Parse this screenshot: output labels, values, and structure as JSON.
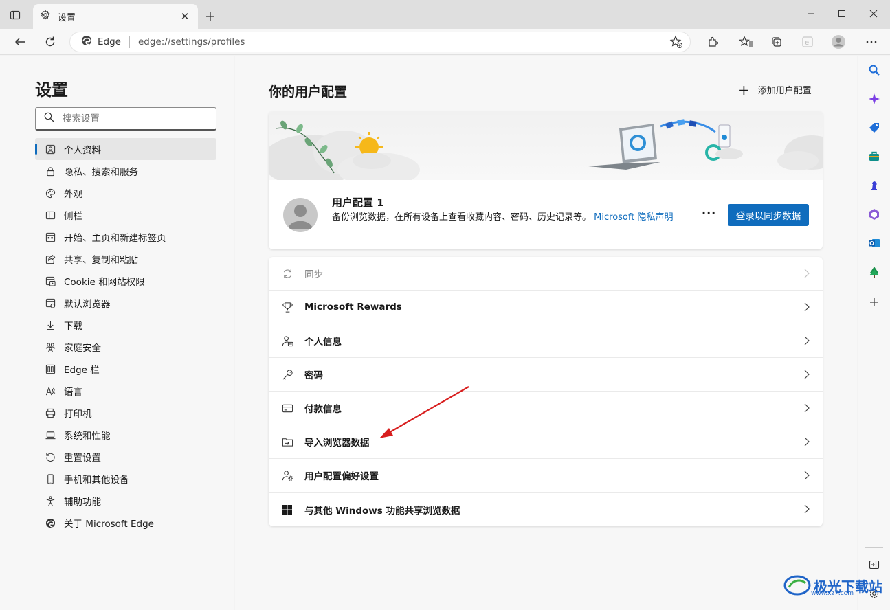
{
  "tab": {
    "title": "设置"
  },
  "address": {
    "site_label": "Edge",
    "url": "edge://settings/profiles"
  },
  "nav": {
    "title": "设置",
    "search_placeholder": "搜索设置",
    "items": [
      {
        "label": "个人资料",
        "icon": "profile-icon",
        "active": true
      },
      {
        "label": "隐私、搜索和服务",
        "icon": "lock-icon"
      },
      {
        "label": "外观",
        "icon": "palette-icon"
      },
      {
        "label": "侧栏",
        "icon": "sidebar-icon"
      },
      {
        "label": "开始、主页和新建标签页",
        "icon": "home-grid-icon"
      },
      {
        "label": "共享、复制和粘贴",
        "icon": "share-icon"
      },
      {
        "label": "Cookie 和网站权限",
        "icon": "site-permissions-icon"
      },
      {
        "label": "默认浏览器",
        "icon": "default-browser-icon"
      },
      {
        "label": "下载",
        "icon": "download-icon"
      },
      {
        "label": "家庭安全",
        "icon": "family-icon"
      },
      {
        "label": "Edge 栏",
        "icon": "edge-bar-icon"
      },
      {
        "label": "语言",
        "icon": "language-icon"
      },
      {
        "label": "打印机",
        "icon": "printer-icon"
      },
      {
        "label": "系统和性能",
        "icon": "laptop-icon"
      },
      {
        "label": "重置设置",
        "icon": "reset-icon"
      },
      {
        "label": "手机和其他设备",
        "icon": "phone-icon"
      },
      {
        "label": "辅助功能",
        "icon": "accessibility-icon"
      },
      {
        "label": "关于 Microsoft Edge",
        "icon": "edge-logo-icon"
      }
    ]
  },
  "main": {
    "title": "你的用户配置",
    "add_profile_label": "添加用户配置",
    "profile": {
      "name": "用户配置 1",
      "description": "备份浏览数据，在所有设备上查看收藏内容、密码、历史记录等。",
      "privacy_link": "Microsoft 隐私声明",
      "more_label": "···",
      "signin_label": "登录以同步数据"
    },
    "settings": [
      {
        "label": "同步",
        "icon": "sync-icon",
        "disabled": true
      },
      {
        "label": "Microsoft Rewards",
        "icon": "trophy-icon"
      },
      {
        "label": "个人信息",
        "icon": "person-info-icon"
      },
      {
        "label": "密码",
        "icon": "key-icon"
      },
      {
        "label": "付款信息",
        "icon": "card-icon"
      },
      {
        "label": "导入浏览器数据",
        "icon": "import-icon"
      },
      {
        "label": "用户配置偏好设置",
        "icon": "profile-prefs-icon"
      },
      {
        "label": "与其他 Windows 功能共享浏览数据",
        "icon": "windows-icon"
      }
    ]
  },
  "watermark": {
    "text": "极光下载站",
    "sub": "www.xz7.com"
  },
  "colors": {
    "accent": "#0f6cbd",
    "arrow": "#d81e1e"
  }
}
